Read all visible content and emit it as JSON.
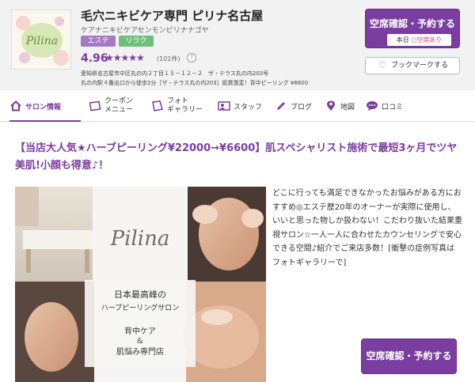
{
  "salon": {
    "name": "毛穴ニキビケア専門 ピリナ名古屋",
    "kana": "ケアナニキビケアセンモンピリナナゴヤ",
    "tags": [
      "エステ",
      "リラク"
    ],
    "rating": "4.96",
    "stars": "★★★★★",
    "review_count": "(101件)",
    "help_icon": "?",
    "address_line1": "愛知県名古屋市中区丸の内２丁目１５－１２－２　ザ・テラス丸の内203号",
    "address_line2": "丸の内駅４番出口から徒歩2分［ザ・テラス丸の内203］肌質激変！背中ピーリング ¥6600"
  },
  "actions": {
    "reserve_label": "空席確認・予約する",
    "today_label": "本日",
    "availability_mark": "○",
    "availability_text": "空席あり",
    "bookmark_label": "ブックマークする",
    "reserve_bottom_label": "空席確認・予約する"
  },
  "nav": {
    "items": [
      {
        "label": "サロン情報",
        "icon": "home-icon"
      },
      {
        "label": "クーポン\nメニュー",
        "icon": "coupon-icon"
      },
      {
        "label": "フォト\nギャラリー",
        "icon": "photo-icon"
      },
      {
        "label": "スタッフ",
        "icon": "staff-icon"
      },
      {
        "label": "ブログ",
        "icon": "pen-icon"
      },
      {
        "label": "地図",
        "icon": "map-pin-icon"
      },
      {
        "label": "口コミ",
        "icon": "chat-icon"
      }
    ]
  },
  "main": {
    "headline": "【当店大人気★ハーブピーリング¥22000→¥6600】肌スペシャリスト施術で最短3ヶ月でツヤ美肌!小顔も得意♪！",
    "photo_logo_text": "Pilina",
    "photo_text1": "日本最高峰の",
    "photo_text2": "ハーブピーリングサロン",
    "photo_text3": "背中ケア",
    "photo_text4": "&",
    "photo_text5": "肌悩み専門店",
    "description": "どこに行っても満足できなかったお悩みがある方におすすめ◎エステ歴20年のオーナーが実際に使用し、いいと思った物しか扱わない！こだわり抜いた結果重視サロン☆一人一人に合わせたカウンセリングで安心できる空間♪紹介でご来店多数！[衝撃の症例写真はフォトギャラリーで]"
  },
  "colors": {
    "brand": "#7a3da0",
    "tag_esthe": "#a67ac2",
    "tag_relax": "#6fbf7a",
    "available": "#e04080"
  }
}
